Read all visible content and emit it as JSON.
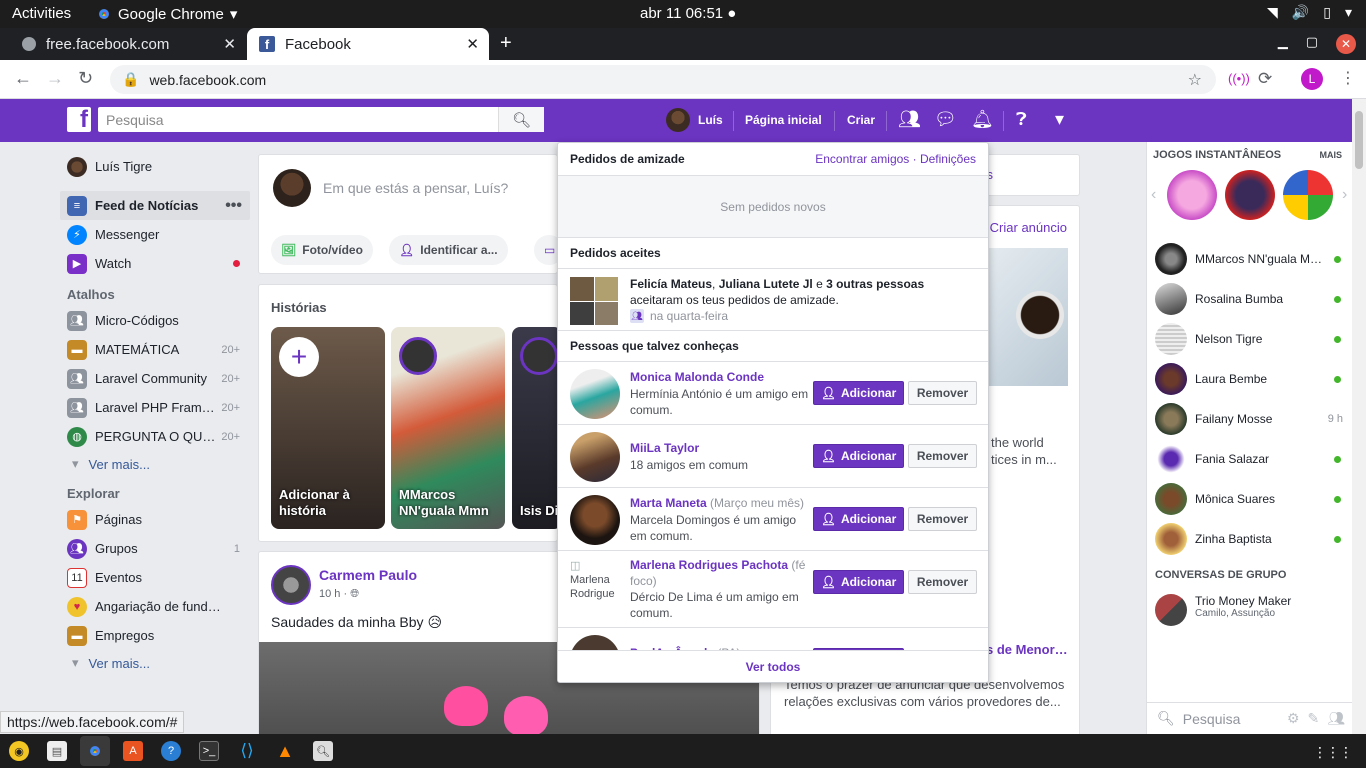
{
  "os": {
    "activities": "Activities",
    "app_name": "Google Chrome",
    "clock": "abr 11  06:51"
  },
  "browser": {
    "tabs": [
      {
        "title": "free.facebook.com"
      },
      {
        "title": "Facebook"
      }
    ],
    "url": "web.facebook.com",
    "profile_initial": "L",
    "status_url": "https://web.facebook.com/#"
  },
  "fb_header": {
    "search_placeholder": "Pesquisa",
    "user": "Luís",
    "home": "Página inicial",
    "create": "Criar"
  },
  "left_sidebar": {
    "profile_name": "Luís Tigre",
    "main": [
      {
        "label": "Feed de Notícias"
      },
      {
        "label": "Messenger"
      },
      {
        "label": "Watch"
      }
    ],
    "shortcuts_title": "Atalhos",
    "shortcuts": [
      {
        "label": "Micro-Códigos",
        "count": ""
      },
      {
        "label": "MATEMÁTICA",
        "count": "20+"
      },
      {
        "label": "Laravel Community",
        "count": "20+"
      },
      {
        "label": "Laravel PHP Fram…",
        "count": "20+"
      },
      {
        "label": "PERGUNTA O QU…",
        "count": "20+"
      }
    ],
    "see_more": "Ver mais...",
    "explore_title": "Explorar",
    "explore": [
      {
        "label": "Páginas",
        "count": ""
      },
      {
        "label": "Grupos",
        "count": "1"
      },
      {
        "label": "Eventos",
        "count": ""
      },
      {
        "label": "Angariação de fund…",
        "count": ""
      },
      {
        "label": "Empregos",
        "count": ""
      }
    ]
  },
  "composer": {
    "placeholder": "Em que estás a pensar, Luís?",
    "photo_video": "Foto/vídeo",
    "tag": "Identificar a..."
  },
  "stories": {
    "title": "Histórias",
    "items": [
      {
        "label": "Adicionar à história"
      },
      {
        "label": "MMarcos NN'guala Mmn"
      },
      {
        "label": "Isis Di"
      }
    ]
  },
  "post": {
    "author": "Carmem Paulo",
    "time": "10 h ·",
    "text": "Saudades da minha Bby 😥"
  },
  "right_middle": {
    "create_ad": "Criar anúncio",
    "partial_text": "the world\ntices in m...",
    "headline": "s de Menor…",
    "desc": "Temos o prazer de anunciar que desenvolvemos relações exclusivas com vários provedores de..."
  },
  "friend_dropdown": {
    "requests_title": "Pedidos de amizade",
    "find_friends": "Encontrar amigos",
    "settings": "Definições",
    "no_requests": "Sem pedidos novos",
    "accepted_title": "Pedidos aceites",
    "accepted_name1": "Felicía Mateus",
    "accepted_name2": "Juliana Lutete Jl",
    "accepted_and": " e ",
    "accepted_others": "3 outras pessoas",
    "accepted_text": "aceitaram os teus pedidos de amizade.",
    "accepted_time": "na quarta-feira",
    "pymk_title": "Pessoas que talvez conheças",
    "people": [
      {
        "name": "Monica Malonda Conde",
        "note": "",
        "desc": "Hermínia António é um amigo em comum."
      },
      {
        "name": "MiiLa Taylor",
        "note": "",
        "desc": "18 amigos em comum"
      },
      {
        "name": "Marta Maneta",
        "note": "(Março meu mês)",
        "desc": "Marcela Domingos é um amigo em comum."
      },
      {
        "name": "Marlena Rodrigues Pachota",
        "note": "(fé foco)",
        "desc": "Dércio De Lima é um amigo em comum."
      },
      {
        "name": "PaulAs Ângela",
        "note": "(PA)",
        "desc": ""
      }
    ],
    "add_label": "Adicionar",
    "remove_label": "Remover",
    "broken_img_alt": "Marlena Rodrigue",
    "see_all": "Ver todos"
  },
  "chat_sidebar": {
    "games_title": "JOGOS INSTANTÂNEOS",
    "more": "MAIS",
    "friends": [
      {
        "name": "MMarcos NN'guala M…",
        "status": "online"
      },
      {
        "name": "Rosalina Bumba",
        "status": "online"
      },
      {
        "name": "Nelson Tigre",
        "status": "online"
      },
      {
        "name": "Laura Bembe",
        "status": "online"
      },
      {
        "name": "Failany Mosse",
        "status": "9 h"
      },
      {
        "name": "Fania Salazar",
        "status": "online"
      },
      {
        "name": "Mônica Suares",
        "status": "online"
      },
      {
        "name": "Zinha Baptista",
        "status": "online"
      }
    ],
    "group_title": "CONVERSAS DE GRUPO",
    "group_name": "Trio Money Maker",
    "group_members": "Camilo, Assunção",
    "search_placeholder": "Pesquisa"
  },
  "colors": {
    "brand": "#6b34c1",
    "online": "#42b72a"
  }
}
